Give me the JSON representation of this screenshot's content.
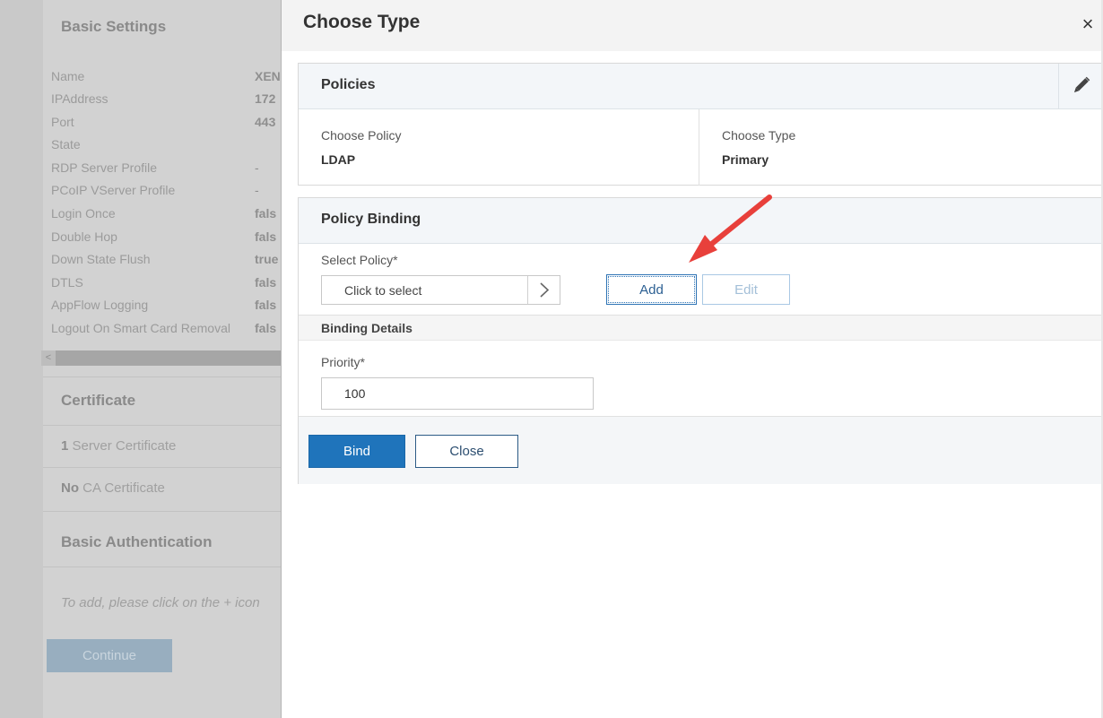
{
  "background": {
    "basic_settings_title": "Basic Settings",
    "settings": [
      {
        "label": "Name",
        "value": "XEN"
      },
      {
        "label": "IPAddress",
        "value": "172"
      },
      {
        "label": "Port",
        "value": "443"
      },
      {
        "label": "State",
        "value": ""
      },
      {
        "label": "RDP Server Profile",
        "value": "-"
      },
      {
        "label": "PCoIP VServer Profile",
        "value": "-"
      },
      {
        "label": "Login Once",
        "value": "fals"
      },
      {
        "label": "Double Hop",
        "value": "fals"
      },
      {
        "label": "Down State Flush",
        "value": "true"
      },
      {
        "label": "DTLS",
        "value": "fals"
      },
      {
        "label": "AppFlow Logging",
        "value": "fals"
      },
      {
        "label": "Logout On Smart Card Removal",
        "value": "fals"
      }
    ],
    "scroll_left_arrow": "<",
    "certificate_title": "Certificate",
    "server_cert_count": "1",
    "server_cert_label": "Server Certificate",
    "ca_cert_count": "No",
    "ca_cert_label": "CA Certificate",
    "basic_auth_title": "Basic Authentication",
    "hint_text": "To add, please click on the + icon",
    "continue_label": "Continue"
  },
  "modal": {
    "title": "Choose Type",
    "close_symbol": "×",
    "policies": {
      "title": "Policies",
      "choose_policy_label": "Choose Policy",
      "choose_policy_value": "LDAP",
      "choose_type_label": "Choose Type",
      "choose_type_value": "Primary"
    },
    "policy_binding": {
      "title": "Policy Binding",
      "select_policy_label": "Select Policy*",
      "select_placeholder": "Click to select",
      "add_label": "Add",
      "edit_label": "Edit",
      "binding_details_title": "Binding Details",
      "priority_label": "Priority*",
      "priority_value": "100",
      "bind_label": "Bind",
      "close_label": "Close"
    }
  },
  "colors": {
    "primary_blue": "#1f74bb",
    "annotation_arrow": "#e8403b"
  }
}
